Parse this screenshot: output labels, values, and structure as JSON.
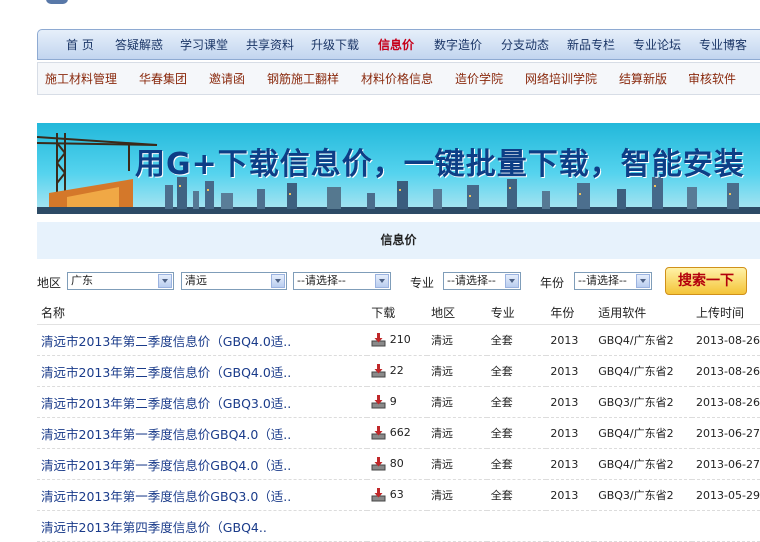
{
  "nav": {
    "items": [
      {
        "label": "首 页",
        "active": false
      },
      {
        "label": "答疑解惑",
        "active": false
      },
      {
        "label": "学习课堂",
        "active": false
      },
      {
        "label": "共享资料",
        "active": false
      },
      {
        "label": "升级下载",
        "active": false
      },
      {
        "label": "信息价",
        "active": true
      },
      {
        "label": "数字造价",
        "active": false
      },
      {
        "label": "分支动态",
        "active": false
      },
      {
        "label": "新品专栏",
        "active": false
      },
      {
        "label": "专业论坛",
        "active": false
      },
      {
        "label": "专业博客",
        "active": false
      }
    ]
  },
  "subnav": {
    "items": [
      "施工材料管理",
      "华春集团",
      "邀请函",
      "钢筋施工翻样",
      "材料价格信息",
      "造价学院",
      "网络培训学院",
      "结算新版",
      "审核软件"
    ]
  },
  "banner": {
    "headline": "用G+下载信息价，一键批量下载，智能安装"
  },
  "section": {
    "title": "信息价"
  },
  "filters": {
    "region_label": "地区",
    "province": "广东",
    "city": "清远",
    "district": "--请选择--",
    "specialty_label": "专业",
    "specialty": "--请选择--",
    "year_label": "年份",
    "year": "--请选择--",
    "search_label": "搜索一下"
  },
  "table": {
    "headers": [
      "名称",
      "下载",
      "地区",
      "专业",
      "年份",
      "适用软件",
      "上传时间"
    ],
    "rows": [
      {
        "name": "清远市2013年第二季度信息价（GBQ4.0适..",
        "downloads": "210",
        "region": "清远",
        "specialty": "全套",
        "year": "2013",
        "software": "GBQ4/广东省2",
        "date": "2013-08-26"
      },
      {
        "name": "清远市2013年第二季度信息价（GBQ4.0适..",
        "downloads": "22",
        "region": "清远",
        "specialty": "全套",
        "year": "2013",
        "software": "GBQ4/广东省2",
        "date": "2013-08-26"
      },
      {
        "name": "清远市2013年第二季度信息价（GBQ3.0适..",
        "downloads": "9",
        "region": "清远",
        "specialty": "全套",
        "year": "2013",
        "software": "GBQ3/广东省2",
        "date": "2013-08-26"
      },
      {
        "name": "清远市2013年第一季度信息价GBQ4.0（适..",
        "downloads": "662",
        "region": "清远",
        "specialty": "全套",
        "year": "2013",
        "software": "GBQ4/广东省2",
        "date": "2013-06-27"
      },
      {
        "name": "清远市2013年第一季度信息价GBQ4.0（适..",
        "downloads": "80",
        "region": "清远",
        "specialty": "全套",
        "year": "2013",
        "software": "GBQ4/广东省2",
        "date": "2013-06-27"
      },
      {
        "name": "清远市2013年第一季度信息价GBQ3.0（适..",
        "downloads": "63",
        "region": "清远",
        "specialty": "全套",
        "year": "2013",
        "software": "GBQ3/广东省2",
        "date": "2013-05-29"
      },
      {
        "name": "清远市2013年第四季度信息价（GBQ4..",
        "downloads": "",
        "region": "",
        "specialty": "",
        "year": "",
        "software": "",
        "date": ""
      }
    ]
  },
  "icons": {
    "download": "download-tray-icon"
  },
  "colors": {
    "nav_active": "#c6001a",
    "link": "#1a3b8a",
    "subnav_text": "#8a2a0e",
    "search_button": "#f4c438"
  }
}
